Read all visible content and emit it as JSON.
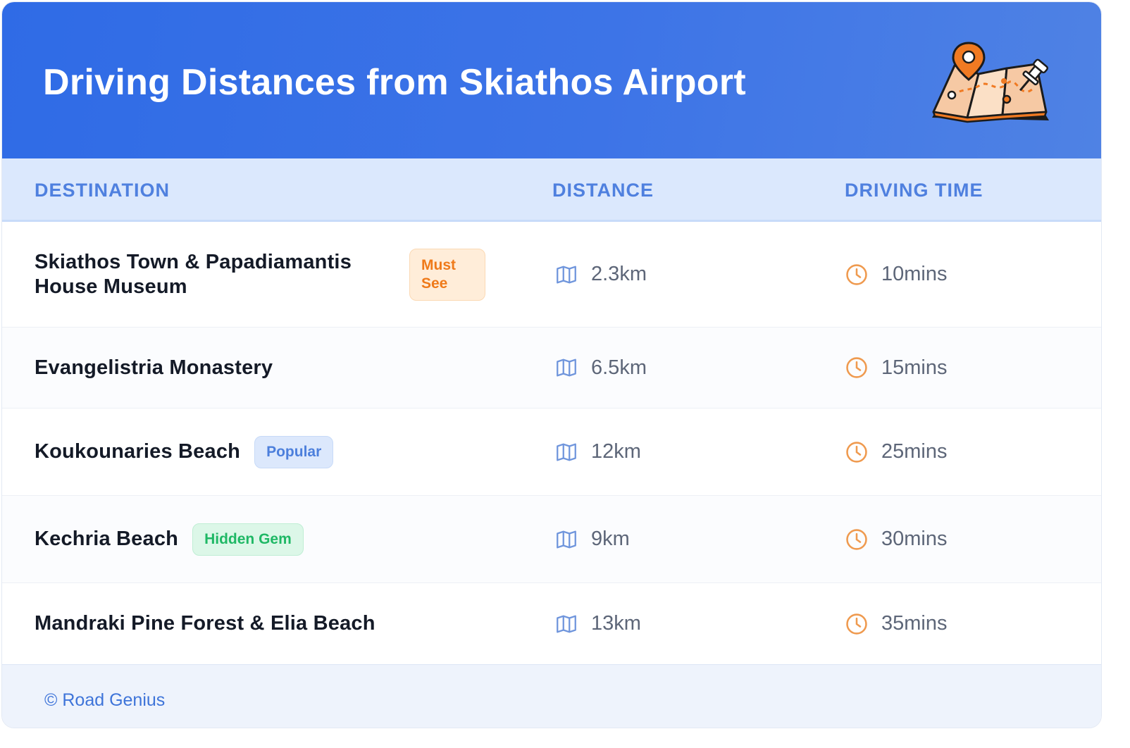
{
  "header": {
    "title": "Driving Distances from Skiathos Airport",
    "illustration": "map-with-pins-icon"
  },
  "columns": {
    "destination": "DESTINATION",
    "distance": "DISTANCE",
    "driving_time": "DRIVING TIME"
  },
  "rows": [
    {
      "destination": "Skiathos Town & Papadiamantis House Museum",
      "badge": "Must See",
      "badge_color": "#ef7a1a",
      "distance": "2.3km",
      "time": "10mins"
    },
    {
      "destination": "Evangelistria Monastery",
      "badge": "",
      "distance": "6.5km",
      "time": "15mins"
    },
    {
      "destination": "Koukounaries Beach",
      "badge": "Popular",
      "badge_color": "#4c7fdc",
      "distance": "12km",
      "time": "25mins"
    },
    {
      "destination": "Kechria Beach",
      "badge": "Hidden Gem",
      "badge_color": "#1fb865",
      "distance": "9km",
      "time": "30mins"
    },
    {
      "destination": "Mandraki Pine Forest & Elia Beach",
      "badge": "",
      "distance": "13km",
      "time": "35mins"
    }
  ],
  "icons": {
    "distance": "map-icon",
    "time": "clock-icon"
  },
  "footer": {
    "credit": "© Road Genius"
  },
  "colors": {
    "header_bg": "#2f6be6",
    "column_header_text": "#4f80df",
    "time_icon": "#ef9a4f",
    "map_icon": "#6f95dc"
  }
}
